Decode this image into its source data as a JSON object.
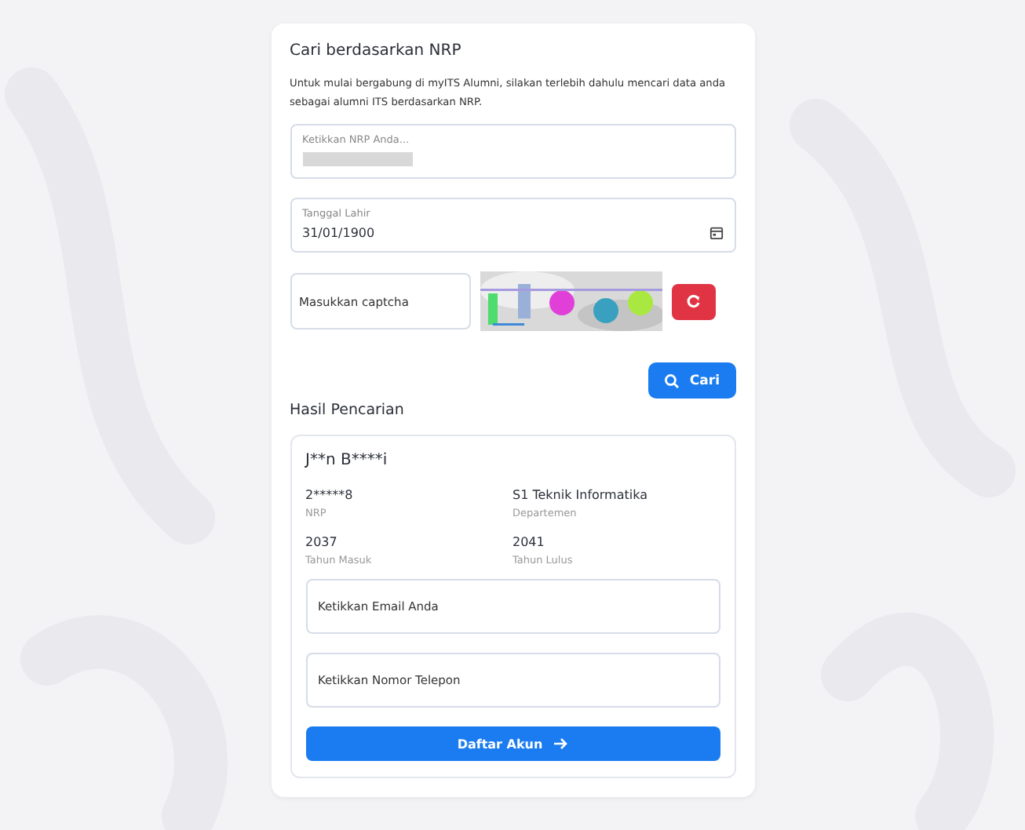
{
  "search": {
    "title": "Cari berdasarkan NRP",
    "description": "Untuk mulai bergabung di myITS Alumni, silakan terlebih dahulu mencari data anda sebagai alumni ITS berdasarkan NRP.",
    "nrp_field": {
      "label": "Ketikkan NRP Anda...",
      "redacted": true
    },
    "birth_date": {
      "label": "Tanggal Lahir",
      "value": "31/01/1900"
    },
    "captcha": {
      "placeholder": "Masukkan captcha"
    },
    "search_button": "Cari"
  },
  "results": {
    "title": "Hasil Pencarian",
    "name": "J**n B****i",
    "fields": [
      {
        "value": "2*****8",
        "label": "NRP"
      },
      {
        "value": "S1 Teknik Informatika",
        "label": "Departemen"
      },
      {
        "value": "2037",
        "label": "Tahun Masuk"
      },
      {
        "value": "2041",
        "label": "Tahun Lulus"
      }
    ],
    "email": {
      "placeholder": "Ketikkan Email Anda"
    },
    "phone": {
      "placeholder": "Ketikkan Nomor Telepon"
    },
    "submit_button": "Daftar Akun"
  }
}
